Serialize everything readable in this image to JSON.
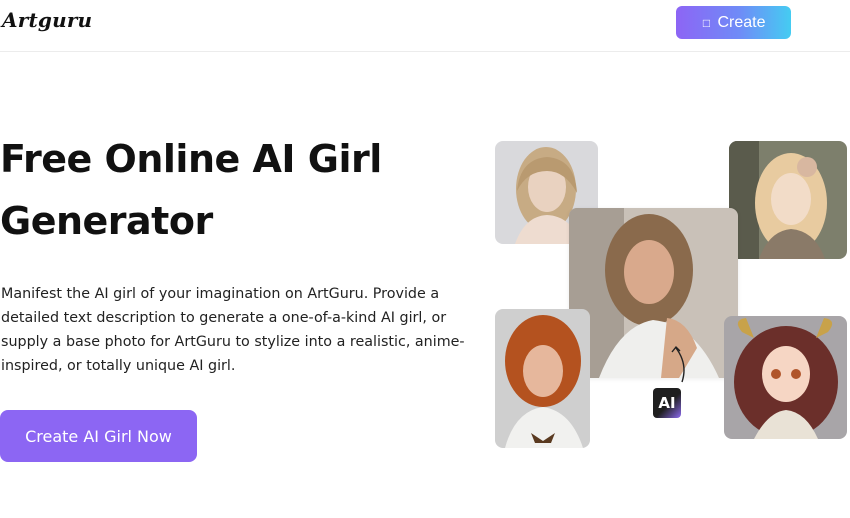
{
  "header": {
    "logo": "Artguru",
    "create_button": {
      "icon": "create-icon",
      "label": "Create"
    }
  },
  "hero": {
    "title_line1": "Free Online AI Girl",
    "title_line2": "Generator",
    "description": "Manifest the AI girl of your imagination on ArtGuru. Provide a detailed text description to generate a one-of-a-kind AI girl, or supply a base photo for ArtGuru to stylize into a realistic, anime-inspired, or totally unique AI girl.",
    "cta_label": "Create AI Girl Now"
  },
  "gallery": {
    "badge": "AI"
  },
  "colors": {
    "accent": "#8c66f3",
    "gradient_start": "#8d65f5",
    "gradient_end": "#45ccf2"
  }
}
